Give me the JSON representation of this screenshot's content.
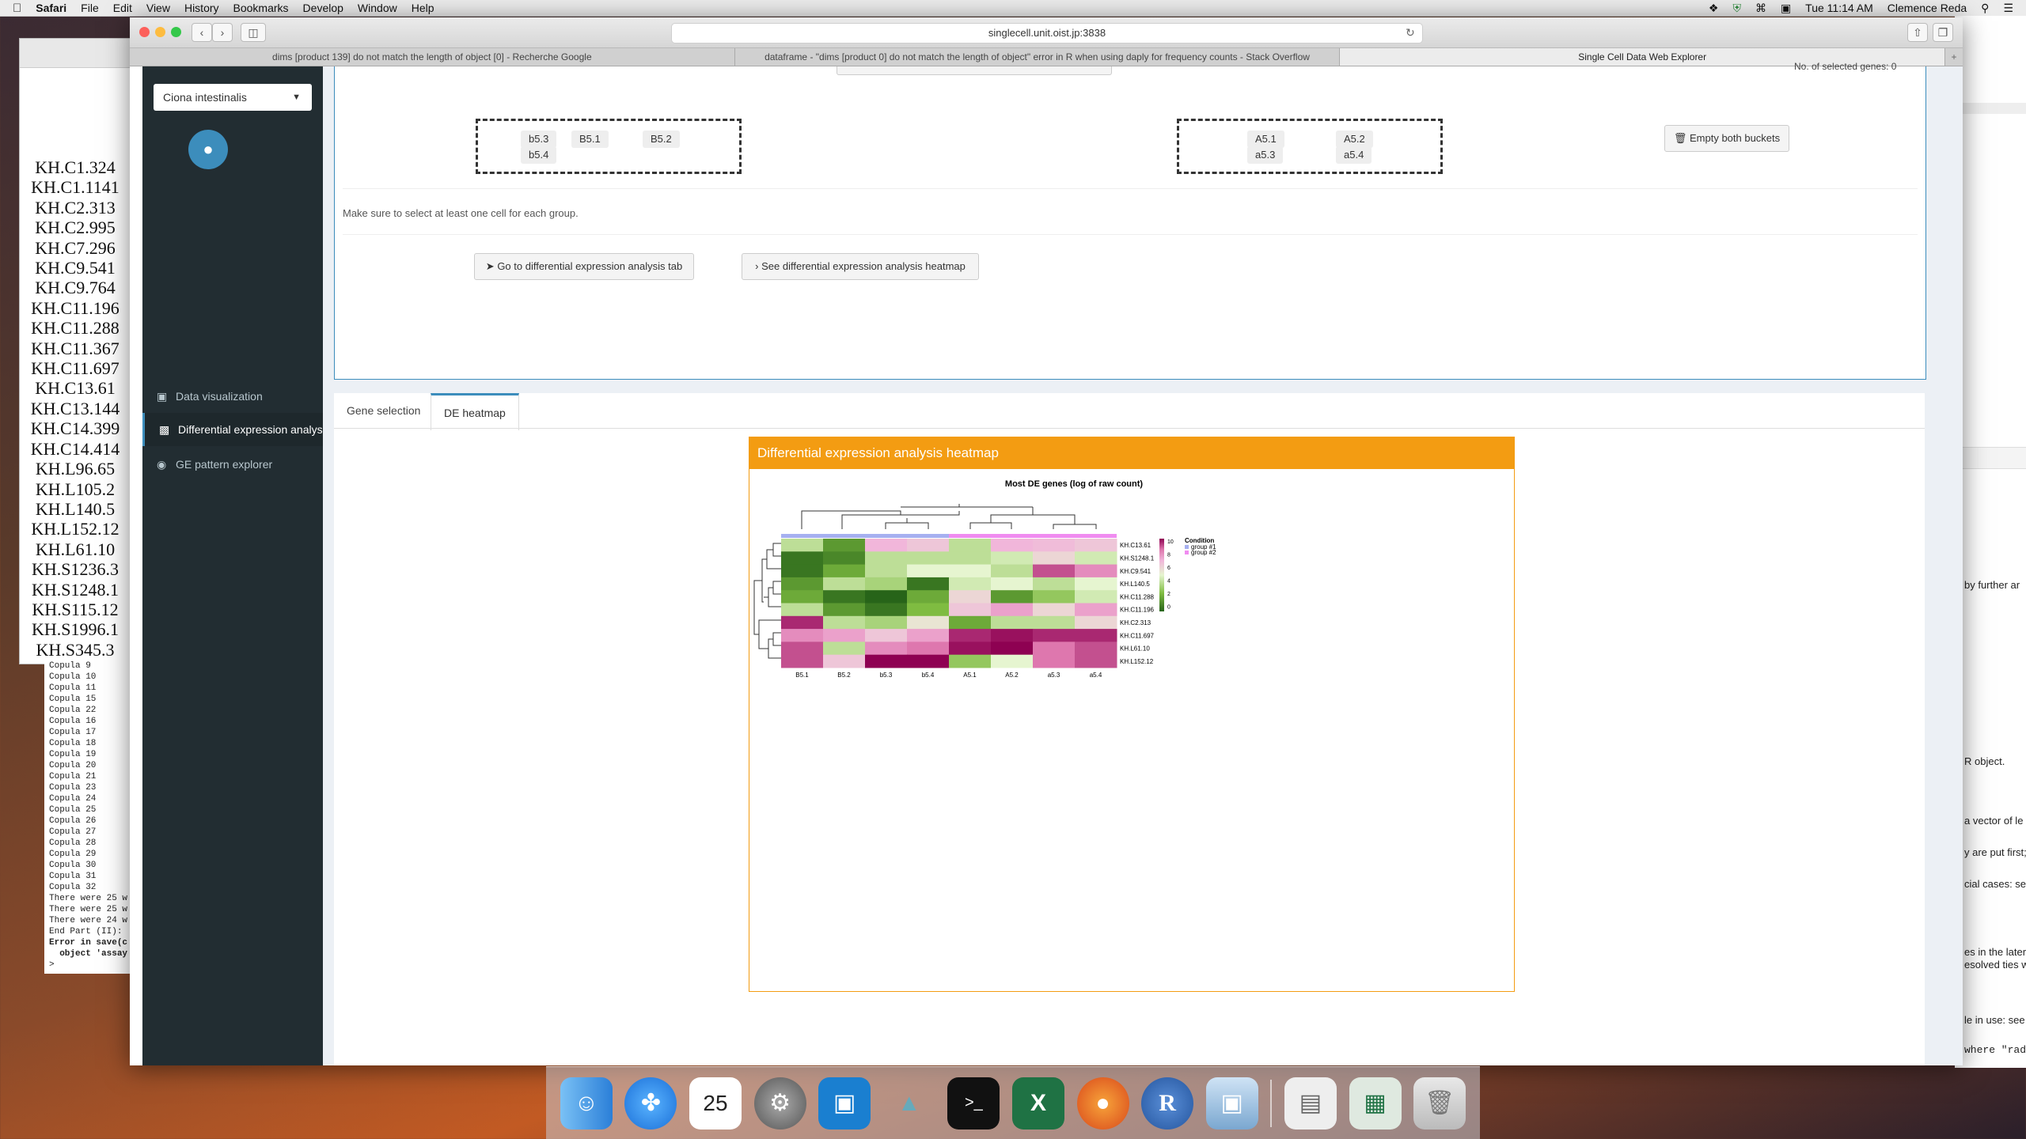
{
  "menubar": {
    "app": "Safari",
    "items": [
      "File",
      "Edit",
      "View",
      "History",
      "Bookmarks",
      "Develop",
      "Window",
      "Help"
    ],
    "clock": "Tue 11:14 AM",
    "user": "Clemence Reda"
  },
  "browser": {
    "url": "singlecell.unit.oist.jp:3838",
    "tabs": [
      "dims [product 139] do not match the length of object [0] - Recherche Google",
      "dataframe - \"dims [product 0] do not match the length of object\" error in R when using daply for frequency counts - Stack Overflow",
      "Single Cell Data Web Explorer"
    ]
  },
  "sidebar": {
    "species": "Ciona intestinalis",
    "items": [
      {
        "label": "Data visualization",
        "icon": "image-icon"
      },
      {
        "label": "Differential expression analysis",
        "icon": "bar-chart-icon"
      },
      {
        "label": "GE pattern explorer",
        "icon": "palette-icon"
      }
    ]
  },
  "selection": {
    "selected_genes_text": "No. of selected genes: 0",
    "bucket1": [
      "b5.3",
      "B5.1",
      "B5.2",
      "b5.4"
    ],
    "bucket2": [
      "A5.1",
      "A5.2",
      "a5.3",
      "a5.4"
    ],
    "empty_button": "Empty both buckets",
    "hint": "Make sure to select at least one cell for each group.",
    "goto_button": "Go to differential expression analysis tab",
    "heatmap_button": "See differential expression analysis heatmap"
  },
  "tabs": {
    "gene_selection": "Gene selection",
    "de_heatmap": "DE heatmap"
  },
  "heatmap": {
    "box_title": "Differential expression analysis heatmap",
    "plot_title": "Most DE genes (log of raw count)",
    "legend_title": "Condition",
    "groups": [
      "group #1",
      "group #2"
    ],
    "scale_ticks": [
      "10",
      "8",
      "6",
      "4",
      "2",
      "0"
    ]
  },
  "chart_data": {
    "type": "heatmap",
    "title": "Most DE genes (log of raw count)",
    "x": [
      "B5.1",
      "B5.2",
      "b5.3",
      "b5.4",
      "A5.1",
      "A5.2",
      "a5.3",
      "a5.4"
    ],
    "y": [
      "KH.C13.61",
      "KH.S1248.1",
      "KH.C9.541",
      "KH.L140.5",
      "KH.C11.288",
      "KH.C11.196",
      "KH.C2.313",
      "KH.C11.697",
      "KH.L61.10",
      "KH.L152.12"
    ],
    "column_condition": [
      "group #1",
      "group #1",
      "group #1",
      "group #1",
      "group #2",
      "group #2",
      "group #2",
      "group #2"
    ],
    "values": [
      [
        4,
        1.5,
        7,
        6.5,
        4,
        7,
        6.8,
        6.5
      ],
      [
        0.5,
        1,
        4,
        4,
        4,
        4.5,
        6,
        4.5
      ],
      [
        0.5,
        2,
        4,
        5,
        5,
        4,
        9,
        8
      ],
      [
        1.5,
        4,
        3.5,
        0.5,
        4.5,
        5,
        4,
        5
      ],
      [
        2,
        0.5,
        0,
        2,
        6,
        1.5,
        3,
        4.5
      ],
      [
        4,
        1.5,
        0.5,
        2.5,
        6.5,
        7.5,
        6,
        7.5
      ],
      [
        9.5,
        4,
        3.5,
        5.5,
        2,
        4,
        4,
        6
      ],
      [
        8,
        7.5,
        6.5,
        7.5,
        9.5,
        9.8,
        9.5,
        9.5
      ],
      [
        9,
        4,
        8,
        8.5,
        9.8,
        10,
        8.5,
        9
      ],
      [
        9,
        6.5,
        10,
        10,
        3,
        5,
        8.5,
        9
      ]
    ],
    "color_scale": {
      "min": 0,
      "max": 10,
      "low": "#276419",
      "mid": "#f7f7f7",
      "high": "#8e0152"
    },
    "condition_colors": {
      "group #1": "#a6b0f0",
      "group #2": "#f08cf0"
    }
  },
  "background": {
    "genelist": [
      "KH.C1.324",
      "KH.C1.1141",
      "KH.C2.313",
      "KH.C2.995",
      "KH.C7.296",
      "KH.C9.541",
      "KH.C9.764",
      "KH.C11.196",
      "KH.C11.288",
      "KH.C11.367",
      "KH.C11.697",
      "KH.C13.61",
      "KH.C13.144",
      "KH.C14.399",
      "KH.C14.414",
      "KH.L96.65",
      "KH.L105.2",
      "KH.L140.5",
      "KH.L152.12",
      "KH.L61.10",
      "KH.S1236.3",
      "KH.S1248.1",
      "KH.S115.12",
      "KH.S1996.1",
      "KH.S345.3"
    ],
    "console": [
      "Copula 9",
      "Copula 10",
      "Copula 11",
      "Copula 15",
      "Copula 22",
      "Copula 16",
      "Copula 17",
      "Copula 18",
      "Copula 19",
      "Copula 20",
      "Copula 21",
      "Copula 23",
      "Copula 24",
      "Copula 25",
      "Copula 26",
      "Copula 27",
      "Copula 28",
      "Copula 29",
      "Copula 30",
      "Copula 31",
      "Copula 32",
      "There were 25 w",
      "There were 25 w",
      "There were 24 w",
      "End Part (II):",
      "Error in save(c",
      "  object 'assay",
      "> "
    ],
    "right_fragments": [
      "by further ar",
      "R object.",
      "a vector of le",
      "y are put first;",
      "cial cases: se",
      "es in the later",
      "esolved ties w",
      "le in use: see",
      "where \"radi"
    ]
  }
}
